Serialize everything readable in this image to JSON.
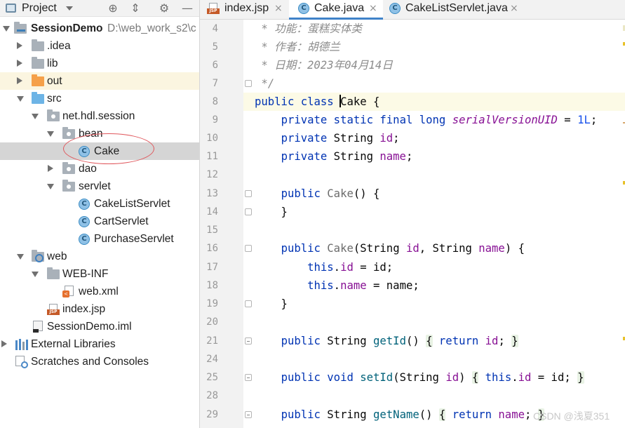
{
  "project_panel": {
    "title": "Project",
    "icons": [
      "locate-icon",
      "collapse-icon",
      "gear-icon",
      "minimize-icon"
    ],
    "tree": [
      {
        "label": "SessionDemo",
        "path": "D:\\web_work_s2\\c",
        "icon": "project-folder-icon",
        "expanded": true
      },
      {
        "label": ".idea",
        "icon": "folder-icon",
        "expanded": false
      },
      {
        "label": "lib",
        "icon": "folder-icon",
        "expanded": false
      },
      {
        "label": "out",
        "icon": "excluded-folder-icon",
        "expanded": false
      },
      {
        "label": "src",
        "icon": "source-folder-icon",
        "expanded": true
      },
      {
        "label": "net.hdl.session",
        "icon": "package-icon",
        "expanded": true
      },
      {
        "label": "bean",
        "icon": "package-icon",
        "expanded": true
      },
      {
        "label": "Cake",
        "icon": "class-icon",
        "selected": true
      },
      {
        "label": "dao",
        "icon": "package-icon",
        "expanded": false
      },
      {
        "label": "servlet",
        "icon": "package-icon",
        "expanded": true
      },
      {
        "label": "CakeListServlet",
        "icon": "class-icon"
      },
      {
        "label": "CartServlet",
        "icon": "class-icon"
      },
      {
        "label": "PurchaseServlet",
        "icon": "class-icon"
      },
      {
        "label": "web",
        "icon": "web-folder-icon",
        "expanded": true
      },
      {
        "label": "WEB-INF",
        "icon": "folder-icon",
        "expanded": true
      },
      {
        "label": "web.xml",
        "icon": "xml-file-icon"
      },
      {
        "label": "index.jsp",
        "icon": "jsp-file-icon"
      },
      {
        "label": "SessionDemo.iml",
        "icon": "iml-file-icon"
      },
      {
        "label": "External Libraries",
        "icon": "libraries-icon",
        "expanded": false
      },
      {
        "label": "Scratches and Consoles",
        "icon": "scratches-icon"
      }
    ]
  },
  "editor": {
    "tabs": [
      {
        "label": "index.jsp",
        "icon": "jsp-file-icon",
        "active": false
      },
      {
        "label": "Cake.java",
        "icon": "class-icon",
        "active": true
      },
      {
        "label": "CakeListServlet.java",
        "icon": "class-icon",
        "active": false
      }
    ],
    "close_glyph": "×",
    "line_numbers": [
      "4",
      "5",
      "6",
      "7",
      "8",
      "9",
      "10",
      "11",
      "12",
      "13",
      "14",
      "15",
      "16",
      "17",
      "18",
      "19",
      "20",
      "21",
      "24",
      "25",
      "28",
      "29"
    ],
    "code_lines": [
      " * 功能：蛋糕实体类",
      " * 作者：胡德兰",
      " * 日期：2023年04月14日",
      " */",
      "public class Cake {",
      "    private static final long serialVersionUID = 1L;",
      "    private String id;",
      "    private String name;",
      "",
      "    public Cake() {",
      "    }",
      "",
      "    public Cake(String id, String name) {",
      "        this.id = id;",
      "        this.name = name;",
      "    }",
      "",
      "    public String getId() { return id; }",
      "",
      "    public void setId(String id) { this.id = id; }",
      "",
      "    public String getName() { return name; }"
    ],
    "current_line": "8"
  },
  "watermark": "CSDN @浅夏351",
  "colors": {
    "keyword": "#0033b3",
    "comment": "#8c8c8c",
    "field": "#871094",
    "number": "#1750eb",
    "method": "#00627a",
    "selection": "#d5d5d5",
    "active_tab_underline": "#4083c9",
    "annotation_circle": "#e0565b"
  }
}
